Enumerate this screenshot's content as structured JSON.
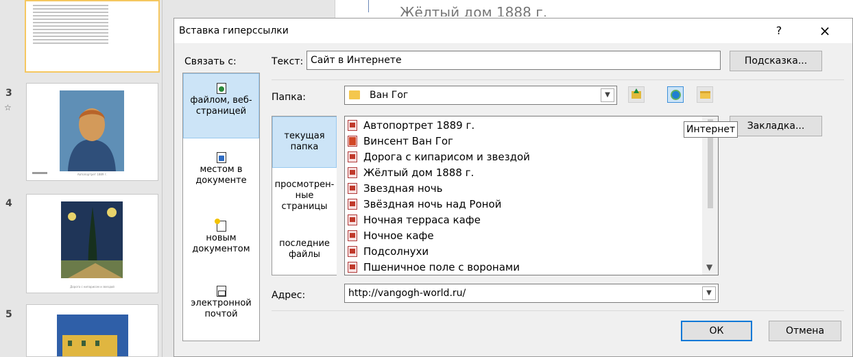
{
  "slides": {
    "items": [
      {
        "number": "3",
        "caption": "Автопортрет 1889 г."
      },
      {
        "number": "4",
        "caption": "Дорога с кипарисом и звездой"
      },
      {
        "number": "5",
        "caption": ""
      }
    ],
    "editor_text": "Жёлтый дом 1888 г."
  },
  "dialog": {
    "title": "Вставка гиперссылки",
    "help": "?",
    "close": "×",
    "link_to_label": "Связать с:",
    "link_to": [
      {
        "label": "файлом, веб-страницей",
        "icon": "file-web-icon"
      },
      {
        "label": "местом в документе",
        "icon": "place-in-document-icon"
      },
      {
        "label": "новым документом",
        "icon": "new-document-icon"
      },
      {
        "label": "электронной почтой",
        "icon": "email-icon"
      }
    ],
    "text_label": "Текст:",
    "text_value": "Сайт в Интернете",
    "screentip_button": "Подсказка...",
    "folder_label": "Папка:",
    "folder_value": "Ван Гог",
    "bookmark_button": "Закладка...",
    "tooltip": "Интернет",
    "look_in": [
      {
        "label": "текущая папка"
      },
      {
        "label": "просмотрен-ные страницы"
      },
      {
        "label": "последние файлы"
      }
    ],
    "files": [
      {
        "name": "Автопортрет 1889 г.",
        "icon": "image-file-icon"
      },
      {
        "name": "Винсент Ван Гог",
        "icon": "powerpoint-file-icon"
      },
      {
        "name": "Дорога с кипарисом и звездой",
        "icon": "image-file-icon"
      },
      {
        "name": "Жёлтый дом 1888 г.",
        "icon": "image-file-icon"
      },
      {
        "name": "Звездная ночь",
        "icon": "image-file-icon"
      },
      {
        "name": "Звёздная ночь над Роной",
        "icon": "image-file-icon"
      },
      {
        "name": "Ночная терраса кафе",
        "icon": "image-file-icon"
      },
      {
        "name": "Ночное кафе",
        "icon": "image-file-icon"
      },
      {
        "name": "Подсолнухи",
        "icon": "image-file-icon"
      },
      {
        "name": "Пшеничное поле с воронами",
        "icon": "image-file-icon"
      }
    ],
    "address_label": "Адрес:",
    "address_value": "http://vangogh-world.ru/",
    "ok_button": "ОК",
    "cancel_button": "Отмена"
  }
}
